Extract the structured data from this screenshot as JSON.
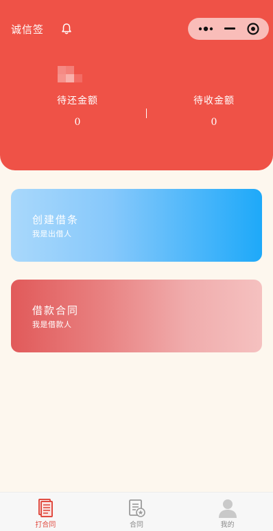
{
  "header": {
    "app_title": "诚信签",
    "stats": [
      {
        "label": "待还金额",
        "value": "0"
      },
      {
        "label": "待收金额",
        "value": "0"
      }
    ]
  },
  "cards": {
    "create": {
      "title": "创建借条",
      "subtitle": "我是出借人"
    },
    "contract": {
      "title": "借款合同",
      "subtitle": "我是借款人"
    }
  },
  "tabbar": {
    "items": [
      {
        "label": "打合同",
        "icon": "document-icon",
        "active": true
      },
      {
        "label": "合同",
        "icon": "contract-icon",
        "active": false
      },
      {
        "label": "我的",
        "icon": "user-icon",
        "active": false
      }
    ]
  },
  "colors": {
    "header_bg": "#ef5247",
    "page_bg": "#fdf7ee",
    "active_tab": "#e04a3f"
  }
}
